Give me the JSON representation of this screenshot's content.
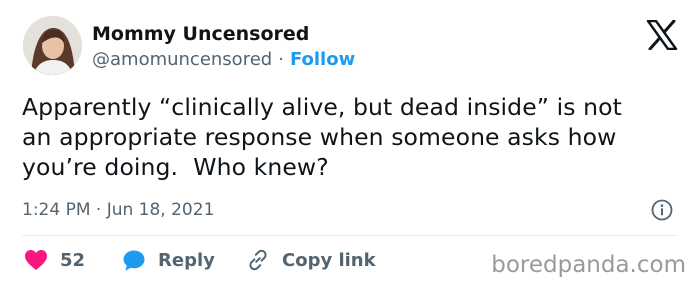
{
  "author": {
    "display_name": "Mommy Uncensored",
    "handle": "@amomuncensored",
    "separator": "·",
    "follow_label": "Follow"
  },
  "tweet": {
    "text": "Apparently “clinically alive, but dead inside” is not\nan appropriate response when someone asks how\nyou’re doing.  Who knew?",
    "timestamp": "1:24 PM · Jun 18, 2021"
  },
  "actions": {
    "like_count": "52",
    "reply_label": "Reply",
    "copy_link_label": "Copy link"
  },
  "watermark": "boredpanda.com",
  "icons": {
    "brand": "x-logo-icon",
    "info": "info-icon",
    "like": "heart-icon",
    "reply": "speech-bubble-icon",
    "copy": "link-icon"
  },
  "colors": {
    "accent": "#1d9bf0",
    "heart": "#f91880",
    "text": "#0f1419",
    "muted": "#536471"
  }
}
